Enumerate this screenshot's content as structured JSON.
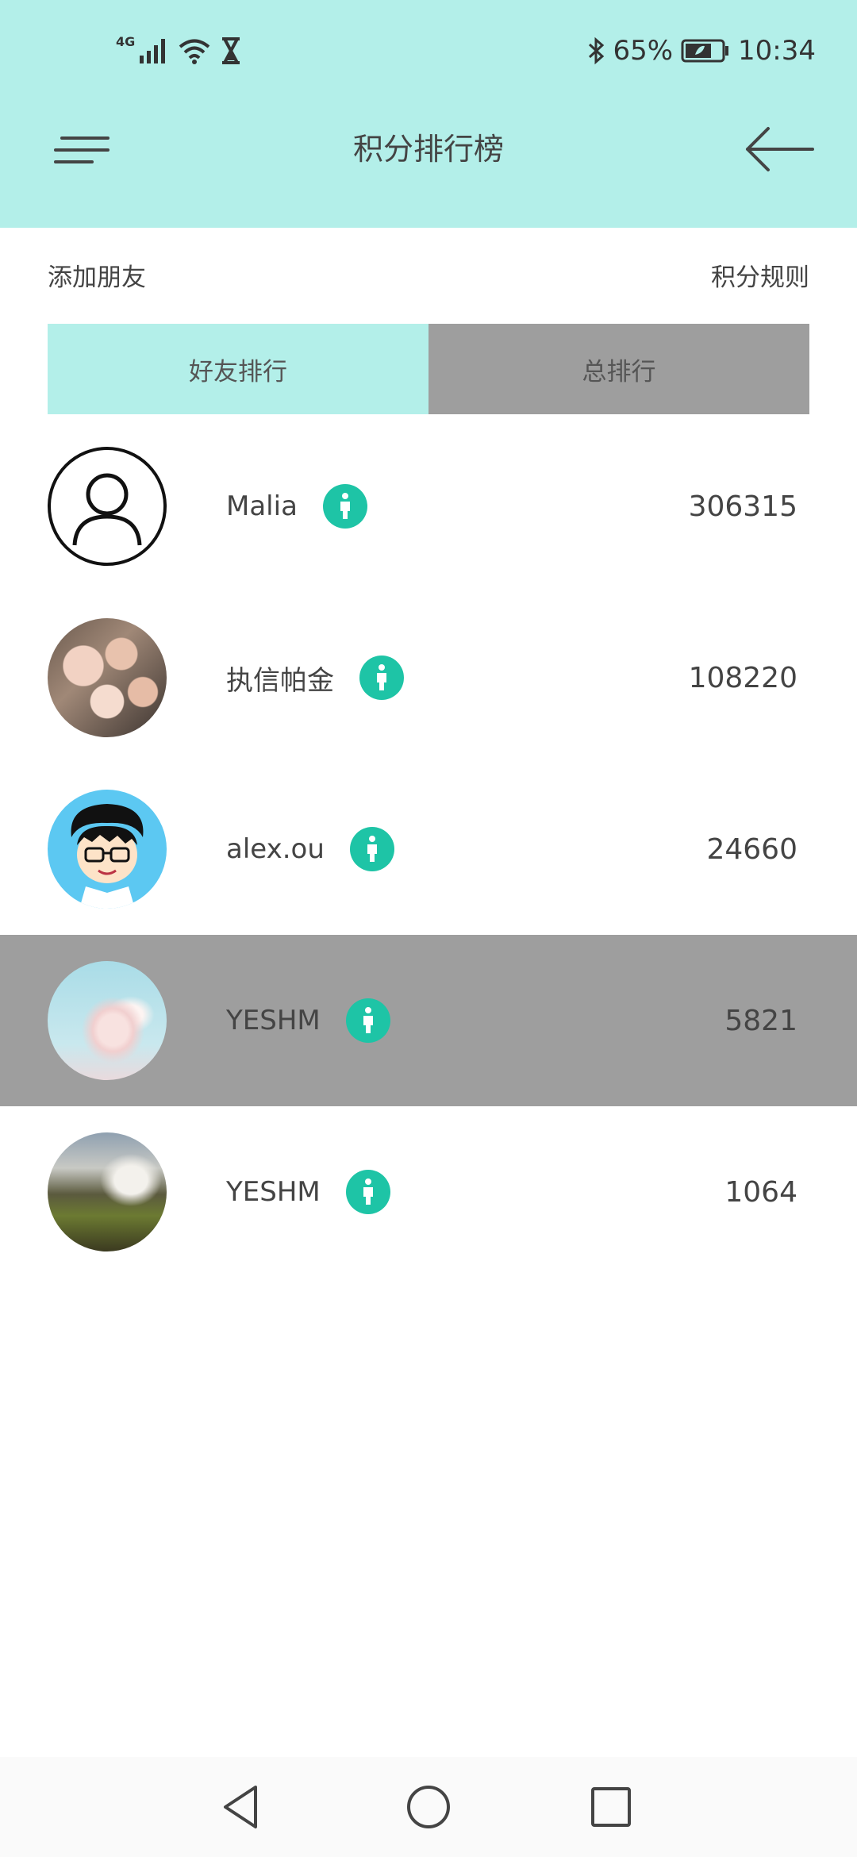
{
  "status_bar": {
    "network": "4G",
    "battery": "65%",
    "time": "10:34",
    "icons": [
      "signal-icon",
      "wifi-icon",
      "hourglass-icon",
      "bluetooth-icon",
      "battery-icon"
    ]
  },
  "header": {
    "title": "积分排行榜",
    "menu_icon": "menu-icon",
    "back_icon": "back-arrow-icon"
  },
  "actions": {
    "add_friend": "添加朋友",
    "rules": "积分规则"
  },
  "tabs": [
    {
      "label": "好友排行",
      "active": true
    },
    {
      "label": "总排行",
      "active": false
    }
  ],
  "ranking": [
    {
      "name": "Malia",
      "score": "306315",
      "avatar": "default-user-avatar",
      "highlighted": false
    },
    {
      "name": "执信帕金",
      "score": "108220",
      "avatar": "group-photo-avatar",
      "highlighted": false
    },
    {
      "name": "alex.ou",
      "score": "24660",
      "avatar": "cartoon-avatar",
      "highlighted": false
    },
    {
      "name": "YESHM",
      "score": "5821",
      "avatar": "sky-cloud-avatar",
      "highlighted": true
    },
    {
      "name": "YESHM",
      "score": "1064",
      "avatar": "waterfall-avatar",
      "highlighted": false
    }
  ],
  "colors": {
    "header_bg": "#b3efe9",
    "active_tab": "#b3efe9",
    "inactive_tab": "#9e9e9e",
    "highlight_row": "#9e9e9e",
    "badge": "#1ec4a6"
  },
  "nav_bar": {
    "buttons": [
      "back-triangle-icon",
      "home-circle-icon",
      "recents-square-icon"
    ]
  }
}
